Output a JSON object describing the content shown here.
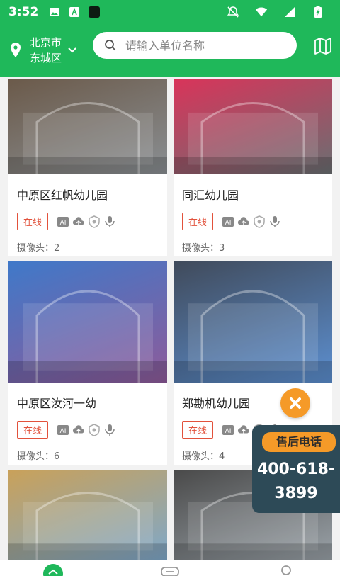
{
  "status_bar": {
    "time": "3:52"
  },
  "header": {
    "city": "北京市",
    "district": "东城区",
    "search_placeholder": "请输入单位名称"
  },
  "colors": {
    "brand_green": "#1fb85a",
    "online_red": "#e2523c",
    "accent_orange": "#f59a28",
    "panel_dark": "#2d4a57"
  },
  "cards": [
    {
      "title": "中原区红帆幼儿园",
      "status": "在线",
      "camera_label": "摄像头：2",
      "theme": [
        "#6b5a4a",
        "#8a8f93"
      ]
    },
    {
      "title": "同汇幼儿园",
      "status": "在线",
      "camera_label": "摄像头：3",
      "theme": [
        "#d9345a",
        "#6a6f72"
      ]
    },
    {
      "title": "中原区汝河一幼",
      "status": "在线",
      "camera_label": "摄像头：6",
      "theme": [
        "#3f79c9",
        "#8e5b9a"
      ]
    },
    {
      "title": "郑勘机幼儿园",
      "status": "在线",
      "camera_label": "摄像头：4",
      "theme": [
        "#404a5a",
        "#5c8fd0"
      ]
    }
  ],
  "partial_cards": [
    {
      "theme": [
        "#c9a15a",
        "#7fa8c9"
      ]
    },
    {
      "theme": [
        "#4a4a4a",
        "#9aa2a8"
      ]
    }
  ],
  "service_panel": {
    "title": "售后电话",
    "phone_line1": "400-618-",
    "phone_line2": "3899"
  }
}
